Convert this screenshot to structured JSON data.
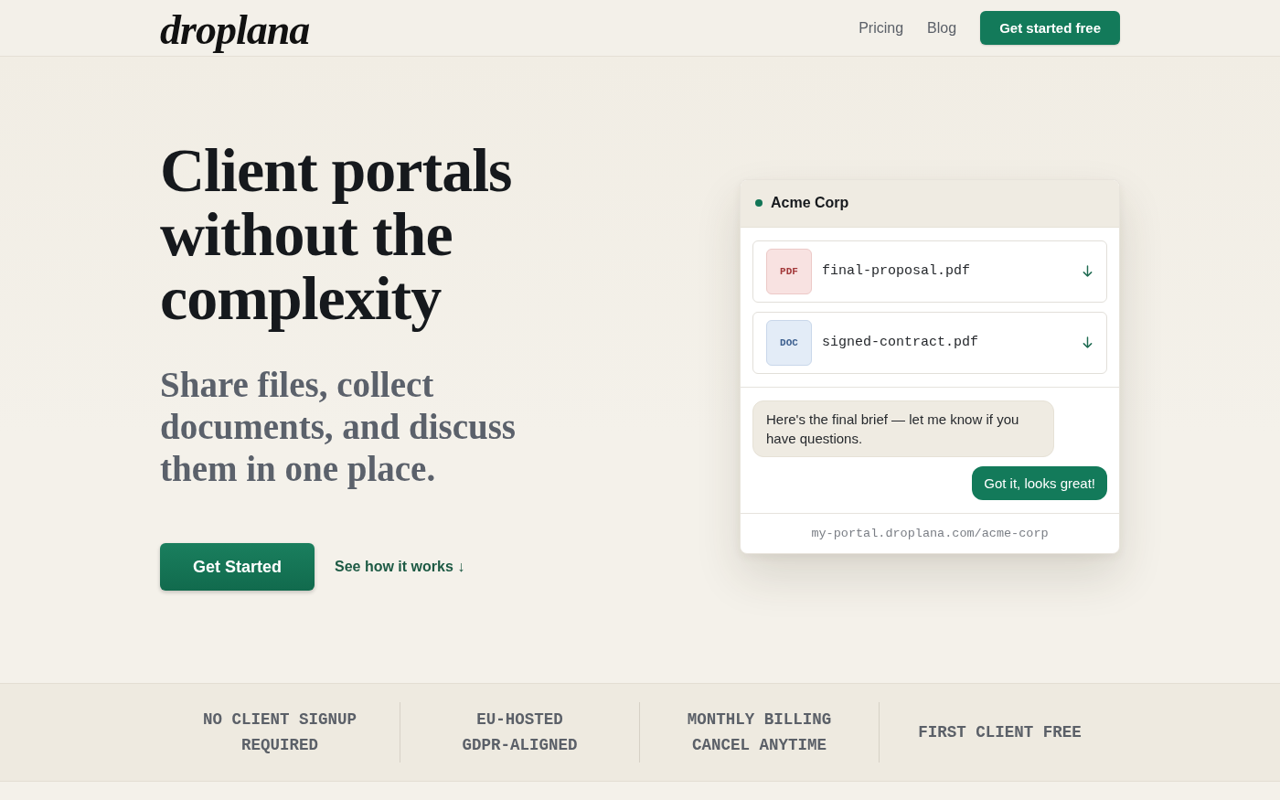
{
  "nav": {
    "logo": "droplana",
    "links": [
      "Pricing",
      "Blog"
    ],
    "cta": "Get started free"
  },
  "hero": {
    "title": "Client portals without the complexity",
    "subtitle": "Share files, collect documents, and discuss them in one place.",
    "primary_button": "Get Started",
    "secondary_link": "See how it works ↓"
  },
  "portal_preview": {
    "client": {
      "name": "Acme Corp",
      "online": true
    },
    "files": [
      {
        "kind": "pdf",
        "badge": "PDF",
        "name": "final-proposal.pdf"
      },
      {
        "kind": "doc",
        "badge": "DOC",
        "name": "signed-contract.pdf"
      }
    ],
    "messages": [
      {
        "kind": "received",
        "text": "Here's the final brief — let me know if you have questions."
      },
      {
        "kind": "sent",
        "text": "Got it, looks great!"
      }
    ],
    "url": "my-portal.droplana.com/acme-corp"
  },
  "features": [
    "NO CLIENT SIGNUP REQUIRED",
    "EU-HOSTED GDPR-ALIGNED",
    "MONTHLY BILLING CANCEL ANYTIME",
    "FIRST CLIENT FREE"
  ]
}
